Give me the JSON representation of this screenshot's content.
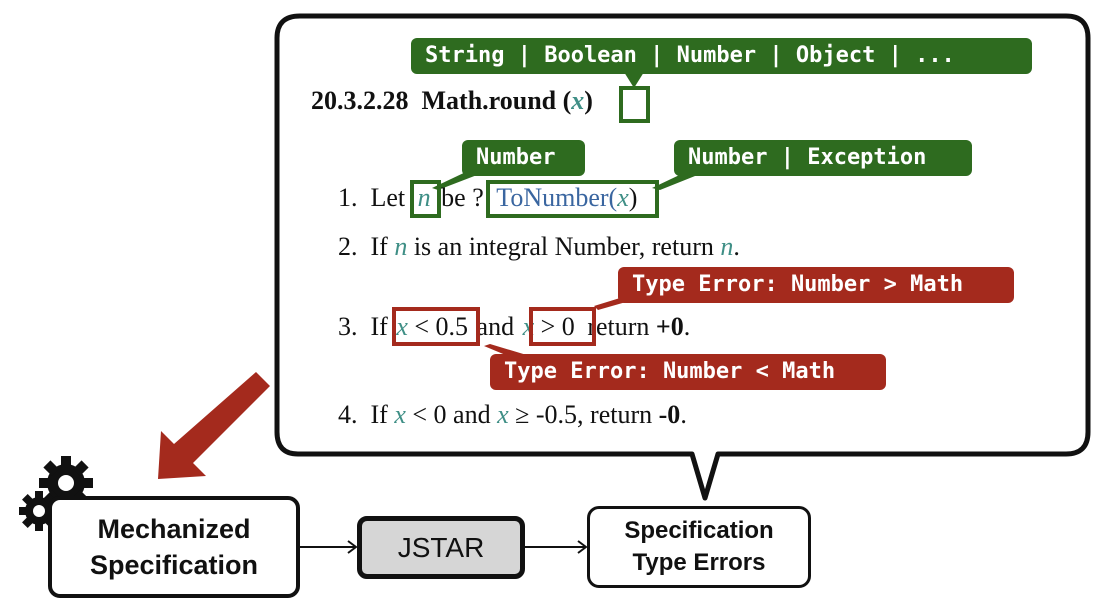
{
  "callout": {
    "section_number": "20.3.2.28",
    "function_name": "Math.round",
    "param": "x",
    "param_type_tag": "String | Boolean | Number | Object | ...",
    "steps": [
      {
        "num": "1.",
        "parts": [
          "Let",
          "n",
          "be ?",
          "ToNumber(",
          "x",
          ")"
        ],
        "tags": [
          "Number",
          "Number | Exception"
        ]
      },
      {
        "num": "2.",
        "parts": [
          "If",
          "n",
          "is an integral Number, return",
          "n",
          "."
        ]
      },
      {
        "num": "3.",
        "parts": [
          "If",
          "x",
          "< 0.5",
          "and",
          "x",
          "> 0",
          "return",
          "+0",
          "."
        ],
        "tags": [
          "Type Error: Number > Math",
          "Type Error: Number < Math"
        ]
      },
      {
        "num": "4.",
        "parts": [
          "If",
          "x",
          "< 0 and",
          "x",
          "≥ -0.5, return",
          "-0",
          "."
        ]
      }
    ]
  },
  "flow": {
    "input_label_line1": "Mechanized",
    "input_label_line2": "Specification",
    "tool_label": "JSTAR",
    "output_label_line1": "Specification",
    "output_label_line2": "Type Errors"
  },
  "colors": {
    "type_tag_green": "#2e6b1f",
    "error_tag_red": "#a42a1d",
    "variable_teal": "#3f8f86",
    "function_blue": "#3a66a0",
    "tool_fill": "#d6d6d6"
  }
}
